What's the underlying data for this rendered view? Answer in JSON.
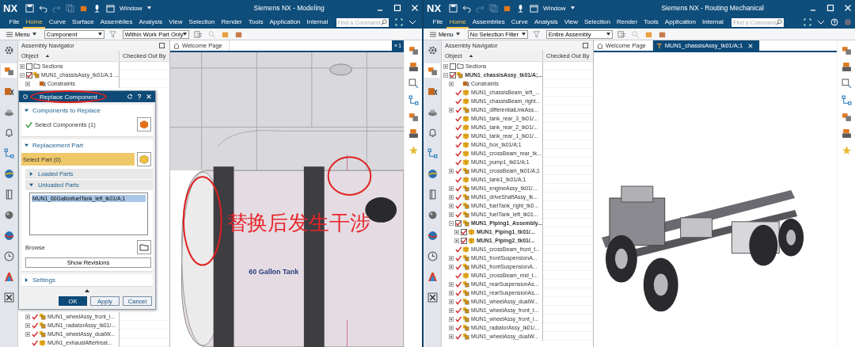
{
  "windows": [
    {
      "logo": "NX",
      "window_menu": "Window",
      "title": "Siemens NX - Modeling",
      "menu": [
        {
          "label": "File",
          "selected": false
        },
        {
          "label": "Home",
          "selected": true
        },
        {
          "label": "Curve",
          "selected": false
        },
        {
          "label": "Surface",
          "selected": false
        },
        {
          "label": "Assemblies",
          "selected": false
        },
        {
          "label": "Analysis",
          "selected": false
        },
        {
          "label": "View",
          "selected": false
        },
        {
          "label": "Selection",
          "selected": false
        },
        {
          "label": "Render",
          "selected": false
        },
        {
          "label": "Tools",
          "selected": false
        },
        {
          "label": "Application",
          "selected": false
        },
        {
          "label": "Internal",
          "selected": false
        }
      ],
      "search": {
        "placeholder": "Find a Command"
      },
      "toolbar": {
        "menu_button": "Menu",
        "filters": [
          "Component",
          "Within Work Part Only"
        ]
      },
      "navigator": {
        "title": "Assembly Navigator",
        "columns": [
          "Object",
          "Checked Out By"
        ],
        "tree": [
          {
            "label": "Sections",
            "kind": "folder",
            "boxed": true,
            "checked": false,
            "bold": false,
            "expanded": false
          },
          {
            "label": "MUN1_chassisAssy_tk01/A;1 ...",
            "kind": "assembly",
            "boxed": true,
            "checked": true,
            "bold": false,
            "expanded": true,
            "children": [
              {
                "label": "Constraints",
                "kind": "constraints",
                "bold": false,
                "expanded": false
              }
            ]
          }
        ],
        "tree_after_dialog": [
          {
            "label": "MUN1_wheelAssy_front_l...",
            "kind": "assembly",
            "boxed": false,
            "checked": true,
            "bold": false,
            "expanded": false
          },
          {
            "label": "MUN1_radiatorAssy_tk01/...",
            "kind": "assembly",
            "boxed": false,
            "checked": true,
            "bold": false,
            "expanded": false
          },
          {
            "label": "MUN1_wheelAssy_dualW...",
            "kind": "assembly",
            "boxed": false,
            "checked": true,
            "bold": false,
            "expanded": false
          },
          {
            "label": "MUN1_exhaustAftertreat...",
            "kind": "part",
            "boxed": false,
            "checked": true,
            "bold": false
          }
        ]
      },
      "dialog": {
        "title": "Replace Component",
        "sections": [
          {
            "title": "Components to Replace",
            "expanded": true,
            "select_label": "Select Components (1)",
            "done": true,
            "active": false
          },
          {
            "title": "Replacement Part",
            "expanded": true,
            "select_label": "Select Part (0)",
            "done": false,
            "active": true,
            "subsections": [
              {
                "title": "Loaded Parts",
                "expanded": false
              },
              {
                "title": "Unloaded Parts",
                "expanded": true,
                "items": [
                  {
                    "label": "MUN1_60GallonfuelTank_left_tk01/A;1",
                    "selected": true
                  }
                ]
              }
            ],
            "browse_label": "Browse",
            "revisions_button": "Show Revisions"
          },
          {
            "title": "Settings",
            "expanded": false
          }
        ],
        "buttons": [
          {
            "label": "OK",
            "primary": true
          },
          {
            "label": "Apply",
            "primary": false
          },
          {
            "label": "Cancel",
            "primary": false
          }
        ]
      },
      "tabs": [
        {
          "label": "Welcome Page",
          "kind": "home",
          "selected": false,
          "closable": false
        }
      ],
      "tab_overflow": "» 1",
      "graphics": {
        "kind": "tank",
        "tank_label": "60 Gallon Tank",
        "annotation": "替换后发生干涉"
      }
    },
    {
      "logo": "NX",
      "window_menu": "Window",
      "title": "Siemens NX - Routing Mechanical",
      "menu": [
        {
          "label": "File",
          "selected": false
        },
        {
          "label": "Home",
          "selected": true
        },
        {
          "label": "Assemblies",
          "selected": false
        },
        {
          "label": "Curve",
          "selected": false
        },
        {
          "label": "Analysis",
          "selected": false
        },
        {
          "label": "View",
          "selected": false
        },
        {
          "label": "Selection",
          "selected": false
        },
        {
          "label": "Render",
          "selected": false
        },
        {
          "label": "Tools",
          "selected": false
        },
        {
          "label": "Application",
          "selected": false
        },
        {
          "label": "Internal",
          "selected": false
        }
      ],
      "search": {
        "placeholder": "Find a Command"
      },
      "toolbar": {
        "menu_button": "Menu",
        "filters": [
          "No Selection Filter",
          "Entire Assembly"
        ]
      },
      "navigator": {
        "title": "Assembly Navigator",
        "columns": [
          "Object",
          "Checked Out By"
        ],
        "tree": [
          {
            "label": "Sections",
            "kind": "folder",
            "boxed": true,
            "checked": false,
            "bold": false,
            "expanded": false
          },
          {
            "label": "MUN1_chassisAssy_tk01/A;...",
            "kind": "assembly",
            "boxed": true,
            "checked": true,
            "bold": true,
            "expanded": true,
            "children": [
              {
                "label": "Constraints",
                "kind": "constraints",
                "bold": false,
                "expanded": false
              },
              {
                "label": "MUN1_chassisBeam_left_...",
                "kind": "part",
                "boxed": false,
                "checked": true,
                "bold": false
              },
              {
                "label": "MUN1_chassisBeam_right...",
                "kind": "part",
                "boxed": false,
                "checked": true,
                "bold": false
              },
              {
                "label": "MUN1_differentialLinkAss...",
                "kind": "assembly",
                "boxed": false,
                "checked": true,
                "bold": false,
                "expanded": false
              },
              {
                "label": "MUN1_tank_rear_3_tk01/...",
                "kind": "part",
                "boxed": false,
                "checked": true,
                "bold": false
              },
              {
                "label": "MUN1_tank_rear_2_tk01/...",
                "kind": "part",
                "boxed": false,
                "checked": true,
                "bold": false
              },
              {
                "label": "MUN1_tank_rear_1_tk01/...",
                "kind": "part",
                "boxed": false,
                "checked": true,
                "bold": false
              },
              {
                "label": "MUN1_box_tk01/A;1",
                "kind": "part",
                "boxed": false,
                "checked": true,
                "bold": false
              },
              {
                "label": "MUN1_crossBeam_rear_tk...",
                "kind": "part",
                "boxed": false,
                "checked": true,
                "bold": false
              },
              {
                "label": "MUN1_pump1_tk01/A;1",
                "kind": "part",
                "boxed": false,
                "checked": true,
                "bold": false
              },
              {
                "label": "MUN1_crossBeam_tk01/A;1",
                "kind": "assembly",
                "boxed": false,
                "checked": true,
                "bold": false,
                "expanded": false
              },
              {
                "label": "MUN1_tank1_tk01/A;1",
                "kind": "part",
                "boxed": false,
                "checked": true,
                "bold": false
              },
              {
                "label": "MUN1_engineAssy_tk01/...",
                "kind": "assembly",
                "boxed": false,
                "checked": true,
                "bold": false,
                "expanded": false
              },
              {
                "label": "MUN1_driveShaftAssy_tk...",
                "kind": "assembly",
                "boxed": false,
                "checked": true,
                "bold": false,
                "expanded": false
              },
              {
                "label": "MUN1_fuelTank_right_tk0...",
                "kind": "assembly",
                "boxed": false,
                "checked": true,
                "bold": false,
                "expanded": false
              },
              {
                "label": "MUN1_fuelTank_left_tk01...",
                "kind": "assembly",
                "boxed": false,
                "checked": true,
                "bold": false,
                "expanded": false
              },
              {
                "label": "MUN1_Piping1_Assembly...",
                "kind": "assembly",
                "boxed": true,
                "checked": true,
                "bold": true,
                "expanded": true,
                "children": [
                  {
                    "label": "MUN1_Piping1_tk01/...",
                    "kind": "part",
                    "boxed": true,
                    "checked": true,
                    "bold": true,
                    "expanded": false
                  },
                  {
                    "label": "MUN1_Piping2_tk01/...",
                    "kind": "part",
                    "boxed": true,
                    "checked": true,
                    "bold": true,
                    "expanded": false
                  }
                ]
              },
              {
                "label": "MUN1_crossBeam_front_t...",
                "kind": "part",
                "boxed": false,
                "checked": true,
                "bold": false
              },
              {
                "label": "MUN1_frontSuspensionA...",
                "kind": "assembly",
                "boxed": false,
                "checked": true,
                "bold": false,
                "expanded": false
              },
              {
                "label": "MUN1_frontSuspensionA...",
                "kind": "assembly",
                "boxed": false,
                "checked": true,
                "bold": false,
                "expanded": false
              },
              {
                "label": "MUN1_crossBeam_mid_t...",
                "kind": "part",
                "boxed": false,
                "checked": true,
                "bold": false
              },
              {
                "label": "MUN1_rearSuspensionAs...",
                "kind": "assembly",
                "boxed": false,
                "checked": true,
                "bold": false,
                "expanded": false
              },
              {
                "label": "MUN1_rearSuspensionAs...",
                "kind": "assembly",
                "boxed": false,
                "checked": true,
                "bold": false,
                "expanded": false
              },
              {
                "label": "MUN1_wheelAssy_dualW...",
                "kind": "assembly",
                "boxed": false,
                "checked": true,
                "bold": false,
                "expanded": false
              },
              {
                "label": "MUN1_wheelAssy_front_t...",
                "kind": "assembly",
                "boxed": false,
                "checked": true,
                "bold": false,
                "expanded": false
              },
              {
                "label": "MUN1_wheelAssy_front_l...",
                "kind": "assembly",
                "boxed": false,
                "checked": true,
                "bold": false,
                "expanded": false
              },
              {
                "label": "MUN1_radiatorAssy_tk01/...",
                "kind": "assembly",
                "boxed": false,
                "checked": true,
                "bold": false,
                "expanded": false
              },
              {
                "label": "MUN1_wheelAssy_dualW...",
                "kind": "assembly",
                "boxed": false,
                "checked": true,
                "bold": false,
                "expanded": false
              }
            ]
          }
        ]
      },
      "tabs": [
        {
          "label": "Welcome Page",
          "kind": "home",
          "selected": false,
          "closable": false
        },
        {
          "label": "MUN1_chassisAssy_tk01/A;1",
          "kind": "part",
          "selected": true,
          "closable": true
        }
      ],
      "graphics": {
        "kind": "truck"
      }
    }
  ]
}
